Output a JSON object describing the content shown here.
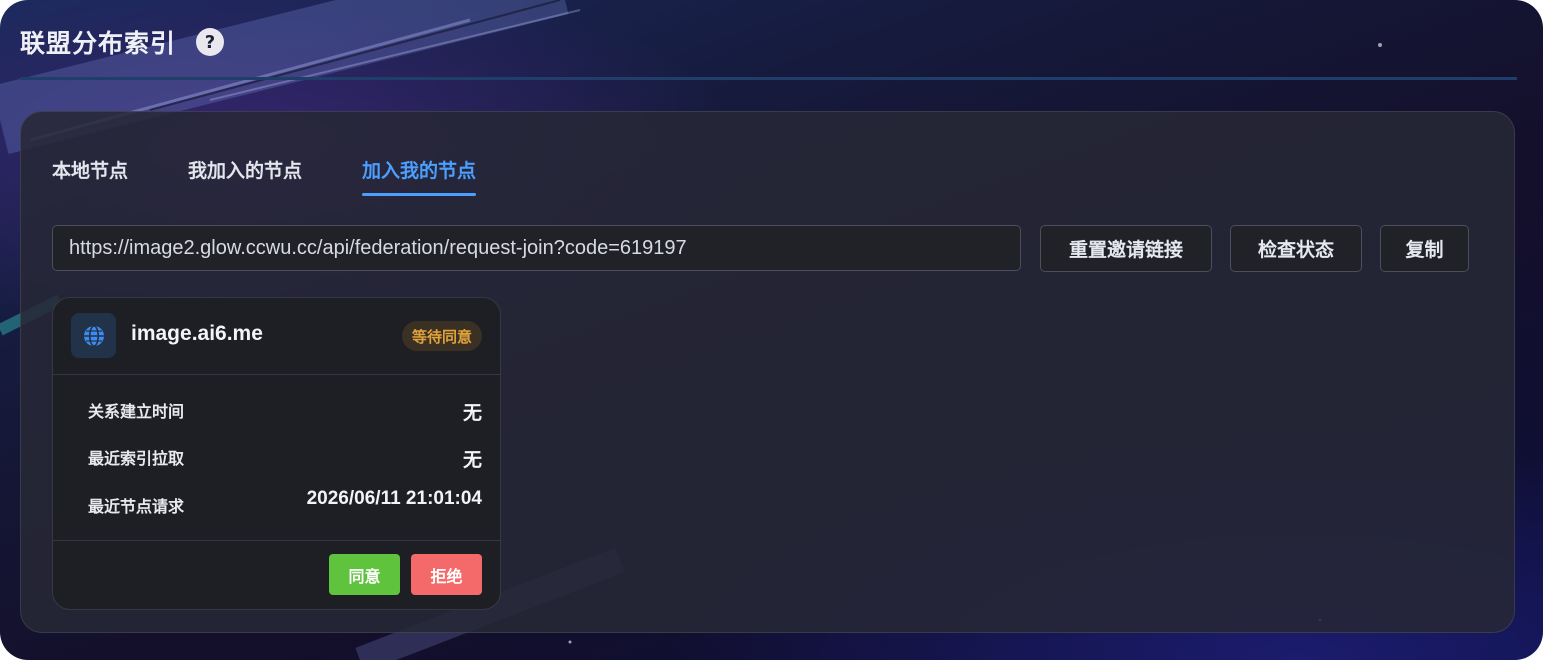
{
  "header": {
    "title": "联盟分布索引",
    "help_icon": "?"
  },
  "tabs": [
    {
      "label": "本地节点",
      "active": false
    },
    {
      "label": "我加入的节点",
      "active": false
    },
    {
      "label": "加入我的节点",
      "active": true
    }
  ],
  "invite": {
    "url": "https://image2.glow.ccwu.cc/api/federation/request-join?code=619197",
    "reset_label": "重置邀请链接",
    "check_label": "检查状态",
    "copy_label": "复制"
  },
  "node_card": {
    "icon": "globe-icon",
    "name": "image.ai6.me",
    "status": "等待同意",
    "rows": [
      {
        "label": "关系建立时间",
        "value": "无"
      },
      {
        "label": "最近索引拉取",
        "value": "无"
      },
      {
        "label": "最近节点请求",
        "value": "2026/06/11 21:01:04"
      }
    ],
    "agree_label": "同意",
    "reject_label": "拒绝"
  },
  "colors": {
    "accent": "#4a9fff",
    "agree": "#5fc33d",
    "reject": "#f46a6a",
    "pending": "#e0a23a"
  }
}
